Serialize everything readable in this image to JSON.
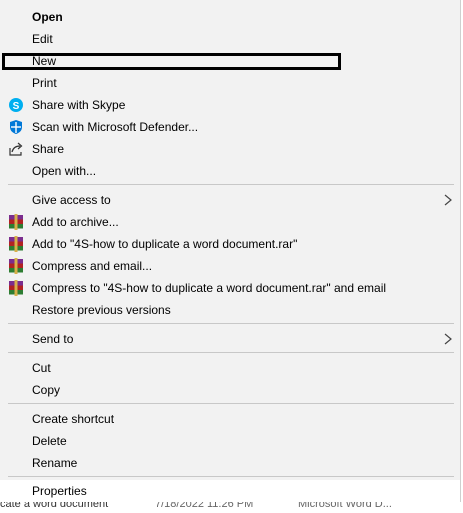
{
  "menu": {
    "items": [
      {
        "label": "Open"
      },
      {
        "label": "Edit"
      },
      {
        "label": "New"
      },
      {
        "label": "Print"
      },
      {
        "label": "Share with Skype",
        "icon": "skype-icon"
      },
      {
        "label": "Scan with Microsoft Defender...",
        "icon": "defender-shield-icon"
      },
      {
        "label": "Share",
        "icon": "share-icon"
      },
      {
        "label": "Open with..."
      },
      {
        "label": "Give access to"
      },
      {
        "label": "Add to archive...",
        "icon": "winrar-icon"
      },
      {
        "label": "Add to \"4S-how to duplicate a word document.rar\"",
        "icon": "winrar-icon"
      },
      {
        "label": "Compress and email...",
        "icon": "winrar-icon"
      },
      {
        "label": "Compress to \"4S-how to duplicate a word document.rar\" and email",
        "icon": "winrar-icon"
      },
      {
        "label": "Restore previous versions"
      },
      {
        "label": "Send to"
      },
      {
        "label": "Cut"
      },
      {
        "label": "Copy"
      },
      {
        "label": "Create shortcut"
      },
      {
        "label": "Delete"
      },
      {
        "label": "Rename"
      },
      {
        "label": "Properties"
      }
    ]
  },
  "background_row": {
    "name": "cate a word document",
    "date": "7/18/2022 11:26 PM",
    "type": "Microsoft Word D..."
  },
  "colors": {
    "menu_bg": "#f2f2f2",
    "separator": "#c8c8c8",
    "skype": "#00aff0",
    "defender": "#0078d7",
    "winrar_red": "#b22222"
  }
}
